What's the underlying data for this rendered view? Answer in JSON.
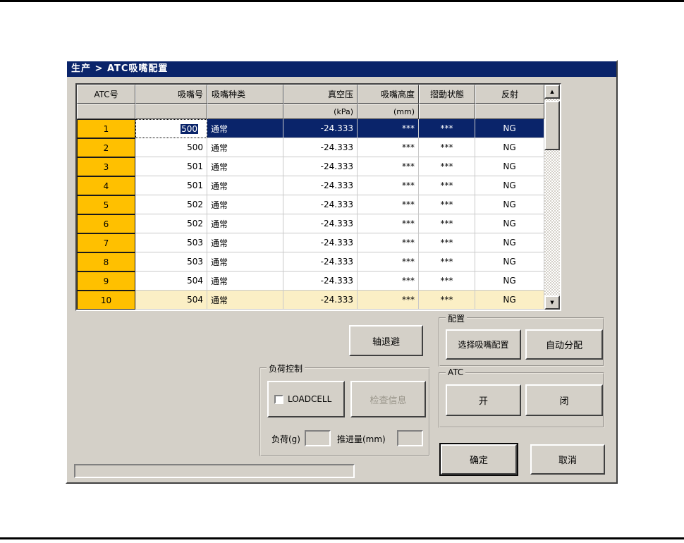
{
  "window": {
    "title": "生产 > ATC吸嘴配置"
  },
  "colors": {
    "titlebar": "#0A246A",
    "orange": "#FFC000",
    "row_selected": "#0A246A",
    "row_highlight": "#FBEFC5"
  },
  "icons": {
    "scroll_up_arrow": "▲",
    "scroll_down_arrow": "▼"
  },
  "table": {
    "columns": [
      {
        "key": "atc",
        "label": "ATC号",
        "unit": ""
      },
      {
        "key": "nozzle",
        "label": "吸嘴号",
        "unit": ""
      },
      {
        "key": "type",
        "label": "吸嘴种类",
        "unit": ""
      },
      {
        "key": "vacuum",
        "label": "真空压",
        "unit": "(kPa)"
      },
      {
        "key": "height",
        "label": "吸嘴高度",
        "unit": "(mm)"
      },
      {
        "key": "slide",
        "label": "摺動状態",
        "unit": ""
      },
      {
        "key": "reflect",
        "label": "反射",
        "unit": ""
      }
    ],
    "rows": [
      {
        "atc": "1",
        "nozzle": "500",
        "type": "通常",
        "vacuum": "-24.333",
        "height": "***",
        "slide": "***",
        "reflect": "NG",
        "selected": true,
        "editing": true
      },
      {
        "atc": "2",
        "nozzle": "500",
        "type": "通常",
        "vacuum": "-24.333",
        "height": "***",
        "slide": "***",
        "reflect": "NG"
      },
      {
        "atc": "3",
        "nozzle": "501",
        "type": "通常",
        "vacuum": "-24.333",
        "height": "***",
        "slide": "***",
        "reflect": "NG"
      },
      {
        "atc": "4",
        "nozzle": "501",
        "type": "通常",
        "vacuum": "-24.333",
        "height": "***",
        "slide": "***",
        "reflect": "NG"
      },
      {
        "atc": "5",
        "nozzle": "502",
        "type": "通常",
        "vacuum": "-24.333",
        "height": "***",
        "slide": "***",
        "reflect": "NG"
      },
      {
        "atc": "6",
        "nozzle": "502",
        "type": "通常",
        "vacuum": "-24.333",
        "height": "***",
        "slide": "***",
        "reflect": "NG"
      },
      {
        "atc": "7",
        "nozzle": "503",
        "type": "通常",
        "vacuum": "-24.333",
        "height": "***",
        "slide": "***",
        "reflect": "NG"
      },
      {
        "atc": "8",
        "nozzle": "503",
        "type": "通常",
        "vacuum": "-24.333",
        "height": "***",
        "slide": "***",
        "reflect": "NG"
      },
      {
        "atc": "9",
        "nozzle": "504",
        "type": "通常",
        "vacuum": "-24.333",
        "height": "***",
        "slide": "***",
        "reflect": "NG"
      },
      {
        "atc": "10",
        "nozzle": "504",
        "type": "通常",
        "vacuum": "-24.333",
        "height": "***",
        "slide": "***",
        "reflect": "NG",
        "highlighted": true
      }
    ]
  },
  "actions": {
    "axis_retract": "轴退避",
    "ok": "确定",
    "cancel": "取消"
  },
  "groups": {
    "config": {
      "label": "配置",
      "select_nozzle_config": "选择吸嘴配置",
      "auto_assign": "自动分配"
    },
    "load_control": {
      "label": "负荷控制",
      "loadcell_label": "LOADCELL",
      "loadcell_checked": false,
      "check_info": "检查信息",
      "load_label": "负荷(g)",
      "load_value": "",
      "advance_label": "推进量(mm)",
      "advance_value": ""
    },
    "atc": {
      "label": "ATC",
      "open": "开",
      "close": "闭"
    }
  },
  "status": {
    "message": ""
  }
}
